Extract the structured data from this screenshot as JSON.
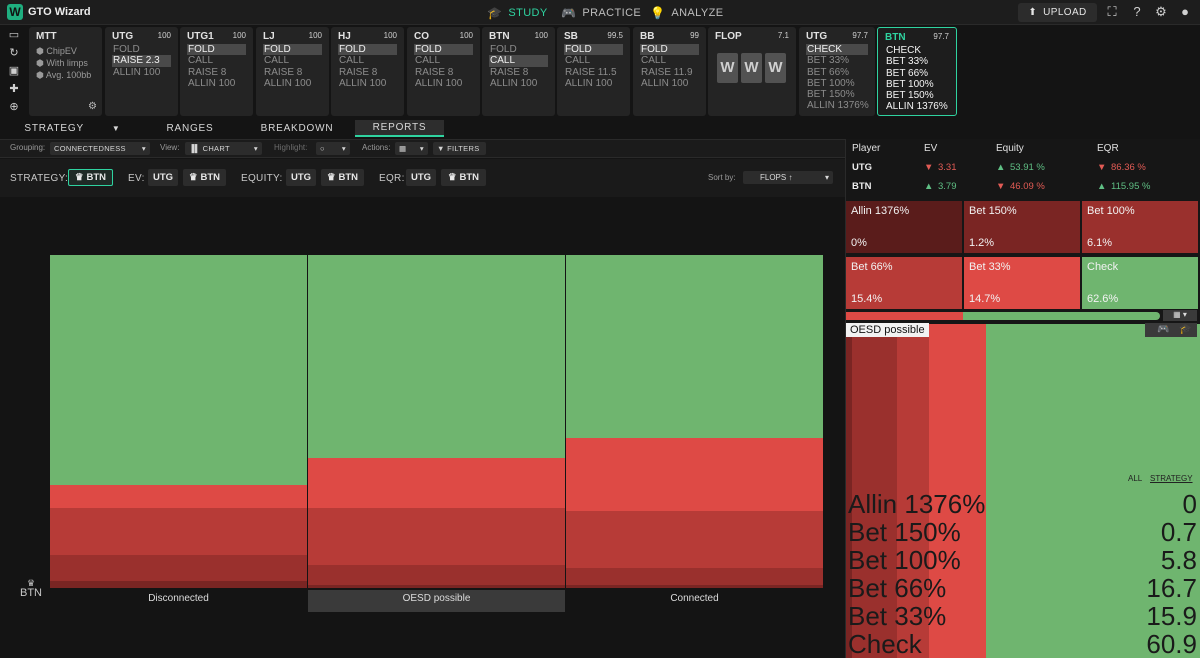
{
  "app": {
    "name": "GTO Wizard",
    "logo_letter": "W"
  },
  "nav": {
    "tabs": [
      {
        "label": "STUDY",
        "icon": "graduation-cap-icon",
        "active": true
      },
      {
        "label": "PRACTICE",
        "icon": "gamepad-icon",
        "active": false
      },
      {
        "label": "ANALYZE",
        "icon": "lightbulb-icon",
        "active": false
      }
    ],
    "upload_label": "UPLOAD"
  },
  "mtt": {
    "title": "MTT",
    "options": [
      "ChipEV",
      "With limps",
      "Avg. 100bb"
    ]
  },
  "positions": [
    {
      "pos": "UTG",
      "stack": "100",
      "actions": [
        "FOLD",
        "RAISE 2.3",
        "ALLIN 100"
      ],
      "selected": 1
    },
    {
      "pos": "UTG1",
      "stack": "100",
      "actions": [
        "FOLD",
        "CALL",
        "RAISE 8",
        "ALLIN 100"
      ],
      "selected": 0
    },
    {
      "pos": "LJ",
      "stack": "100",
      "actions": [
        "FOLD",
        "CALL",
        "RAISE 8",
        "ALLIN 100"
      ],
      "selected": 0
    },
    {
      "pos": "HJ",
      "stack": "100",
      "actions": [
        "FOLD",
        "CALL",
        "RAISE 8",
        "ALLIN 100"
      ],
      "selected": 0
    },
    {
      "pos": "CO",
      "stack": "100",
      "actions": [
        "FOLD",
        "CALL",
        "RAISE 8",
        "ALLIN 100"
      ],
      "selected": 0
    },
    {
      "pos": "BTN",
      "stack": "100",
      "actions": [
        "FOLD",
        "CALL",
        "RAISE 8",
        "ALLIN 100"
      ],
      "selected": 1
    },
    {
      "pos": "SB",
      "stack": "99.5",
      "actions": [
        "FOLD",
        "CALL",
        "RAISE 11.5",
        "ALLIN 100"
      ],
      "selected": 0
    },
    {
      "pos": "BB",
      "stack": "99",
      "actions": [
        "FOLD",
        "CALL",
        "RAISE 11.9",
        "ALLIN 100"
      ],
      "selected": 0
    }
  ],
  "flop": {
    "title": "FLOP",
    "pot": "7.1",
    "slots": [
      "W",
      "W",
      "W"
    ]
  },
  "utg_node": {
    "pos": "UTG",
    "stack": "97.7",
    "actions": [
      "CHECK",
      "BET 33%",
      "BET 66%",
      "BET 100%",
      "BET 150%",
      "ALLIN 1376%"
    ],
    "selected": 0
  },
  "btn_node": {
    "pos": "BTN",
    "stack": "97.7",
    "actions": [
      "CHECK",
      "BET 33%",
      "BET 66%",
      "BET 100%",
      "BET 150%",
      "ALLIN 1376%"
    ]
  },
  "subtabs": [
    "STRATEGY",
    "RANGES",
    "BREAKDOWN",
    "REPORTS"
  ],
  "filters": {
    "grouping_label": "Grouping:",
    "grouping_value": "CONNECTEDNESS",
    "view_label": "View:",
    "view_value": "CHART",
    "highlight_label": "Highlight:",
    "actions_label": "Actions:",
    "filters_button": "FILTERS"
  },
  "strategy_row": {
    "strategy_label": "STRATEGY:",
    "ev_label": "EV:",
    "equity_label": "EQUITY:",
    "eqr_label": "EQR:",
    "utg": "UTG",
    "btn": "BTN",
    "sortby_label": "Sort by:",
    "sortby_value": "FLOPS"
  },
  "colors": {
    "check": "#6fb56f",
    "bet33": "#de4a45",
    "bet66": "#b73b37",
    "bet100": "#9a302d",
    "bet150": "#7a2523",
    "allin": "#5a1c1b",
    "accent": "#2fd3a0"
  },
  "chart_data": {
    "type": "bar",
    "stacked": true,
    "categories": [
      "Disconnected",
      "OESD possible",
      "Connected"
    ],
    "series": [
      {
        "name": "Allin 1376%",
        "values": [
          0,
          0,
          0
        ]
      },
      {
        "name": "Bet 150%",
        "values": [
          2,
          1,
          1
        ]
      },
      {
        "name": "Bet 100%",
        "values": [
          8,
          6,
          5
        ]
      },
      {
        "name": "Bet 66%",
        "values": [
          14,
          17,
          17
        ]
      },
      {
        "name": "Bet 33%",
        "values": [
          7,
          15,
          22
        ]
      },
      {
        "name": "Check",
        "values": [
          69,
          61,
          55
        ]
      }
    ],
    "ylim": [
      0,
      100
    ],
    "selected_category": "OESD possible",
    "player_label": "BTN"
  },
  "stats_table": {
    "headers": [
      "Player",
      "EV",
      "Equity",
      "EQR"
    ],
    "rows": [
      {
        "player": "UTG",
        "ev": "3.31",
        "ev_dir": "down",
        "equity": "53.91 %",
        "eq_dir": "up",
        "eqr": "86.36 %",
        "eqr_dir": "down"
      },
      {
        "player": "BTN",
        "ev": "3.79",
        "ev_dir": "up",
        "equity": "46.09 %",
        "eq_dir": "down",
        "eqr": "115.95 %",
        "eqr_dir": "up"
      }
    ]
  },
  "action_tiles": [
    {
      "label": "Allin 1376%",
      "value": "0%"
    },
    {
      "label": "Bet 150%",
      "value": "1.2%"
    },
    {
      "label": "Bet 100%",
      "value": "6.1%"
    },
    {
      "label": "Bet 66%",
      "value": "15.4%"
    },
    {
      "label": "Bet 33%",
      "value": "14.7%"
    },
    {
      "label": "Check",
      "value": "62.6%"
    }
  ],
  "detail": {
    "title": "OESD possible",
    "toggle_all": "ALL",
    "toggle_strategy": "STRATEGY",
    "rows": [
      {
        "label": "Allin 1376%",
        "value": "0"
      },
      {
        "label": "Bet 150%",
        "value": "0.7"
      },
      {
        "label": "Bet 100%",
        "value": "5.8"
      },
      {
        "label": "Bet 66%",
        "value": "16.7"
      },
      {
        "label": "Bet 33%",
        "value": "15.9"
      },
      {
        "label": "Check",
        "value": "60.9"
      }
    ]
  }
}
